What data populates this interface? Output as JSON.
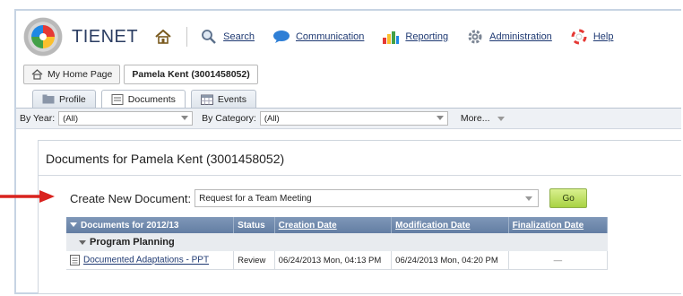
{
  "app": {
    "brand": "TIENET"
  },
  "nav": {
    "items": [
      {
        "label": "Search",
        "icon": "search-icon"
      },
      {
        "label": "Communication",
        "icon": "chat-bubble-icon"
      },
      {
        "label": "Reporting",
        "icon": "bar-chart-icon"
      },
      {
        "label": "Administration",
        "icon": "gear-icon"
      },
      {
        "label": "Help",
        "icon": "lifebuoy-icon"
      }
    ]
  },
  "breadcrumb": {
    "home": "My Home Page",
    "current": "Pamela Kent (3001458052)"
  },
  "tabs": [
    {
      "label": "Profile"
    },
    {
      "label": "Documents"
    },
    {
      "label": "Events"
    }
  ],
  "filters": {
    "year_label": "By Year:",
    "year_value": "(All)",
    "category_label": "By Category:",
    "category_value": "(All)",
    "more_label": "More..."
  },
  "panel": {
    "title": "Documents for Pamela Kent (3001458052)",
    "create_label": "Create New Document:",
    "create_value": "Request for a Team Meeting",
    "go_label": "Go"
  },
  "table": {
    "headers": [
      "Documents for 2012/13",
      "Status",
      "Creation Date",
      "Modification Date",
      "Finalization Date"
    ],
    "group": "Program Planning",
    "rows": [
      {
        "title": "Documented Adaptations - PPT",
        "status": "Review",
        "created": "06/24/2013 Mon, 04:13 PM",
        "modified": "06/24/2013 Mon, 04:20 PM",
        "finalized": "—"
      }
    ]
  },
  "colors": {
    "header_bg": "#6f88ac",
    "go_button": "#b9dd5a",
    "arrow": "#d9231f",
    "link": "#1f3a73"
  }
}
